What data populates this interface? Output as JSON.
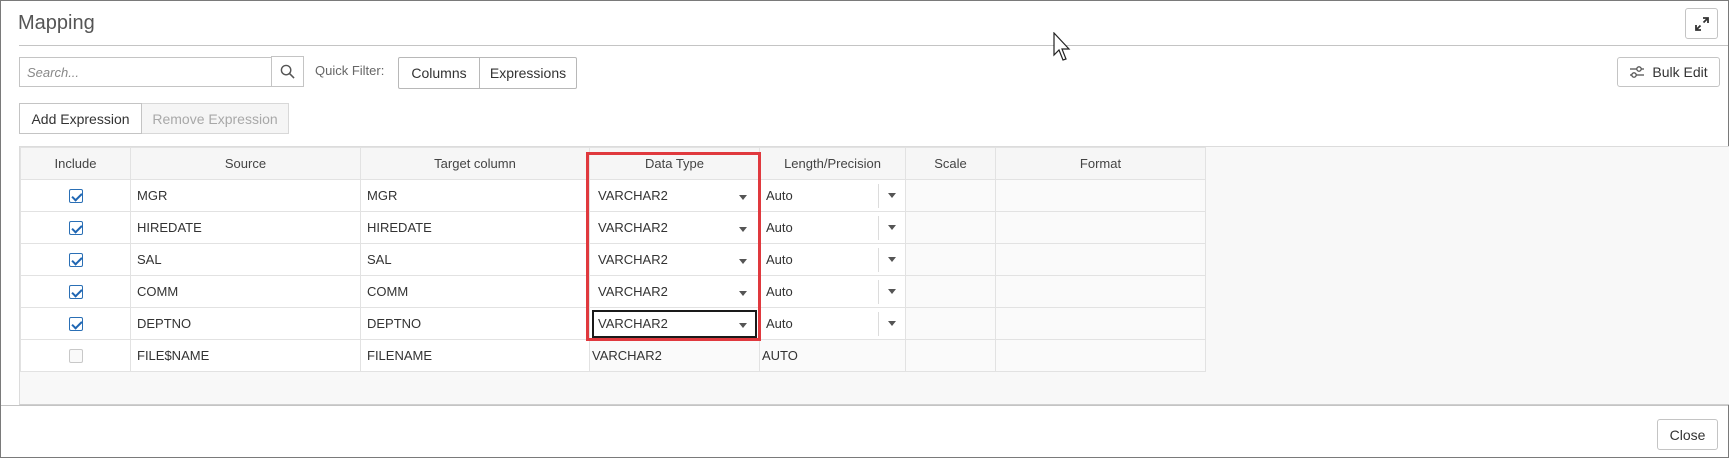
{
  "dialog": {
    "title": "Mapping"
  },
  "toolbar": {
    "search_placeholder": "Search...",
    "quick_filter_label": "Quick Filter:",
    "filter_columns": "Columns",
    "filter_expressions": "Expressions",
    "bulk_edit": "Bulk Edit",
    "add_expression": "Add Expression",
    "remove_expression": "Remove Expression"
  },
  "grid": {
    "headers": [
      "Include",
      "Source",
      "Target column",
      "Data Type",
      "Length/Precision",
      "Scale",
      "Format"
    ],
    "rows": [
      {
        "include": true,
        "source": "MGR",
        "target": "MGR",
        "data_type": "VARCHAR2",
        "length": "Auto",
        "editable": true
      },
      {
        "include": true,
        "source": "HIREDATE",
        "target": "HIREDATE",
        "data_type": "VARCHAR2",
        "length": "Auto",
        "editable": true
      },
      {
        "include": true,
        "source": "SAL",
        "target": "SAL",
        "data_type": "VARCHAR2",
        "length": "Auto",
        "editable": true
      },
      {
        "include": true,
        "source": "COMM",
        "target": "COMM",
        "data_type": "VARCHAR2",
        "length": "Auto",
        "editable": true
      },
      {
        "include": true,
        "source": "DEPTNO",
        "target": "DEPTNO",
        "data_type": "VARCHAR2",
        "length": "Auto",
        "editable": true,
        "focused": true
      },
      {
        "include": false,
        "source": "FILE$NAME",
        "target": "FILENAME",
        "data_type": "VARCHAR2",
        "length": "AUTO",
        "editable": false
      }
    ]
  },
  "footer": {
    "close": "Close"
  },
  "colors": {
    "highlight": "#e0393e",
    "checkbox": "#1f66b3"
  }
}
